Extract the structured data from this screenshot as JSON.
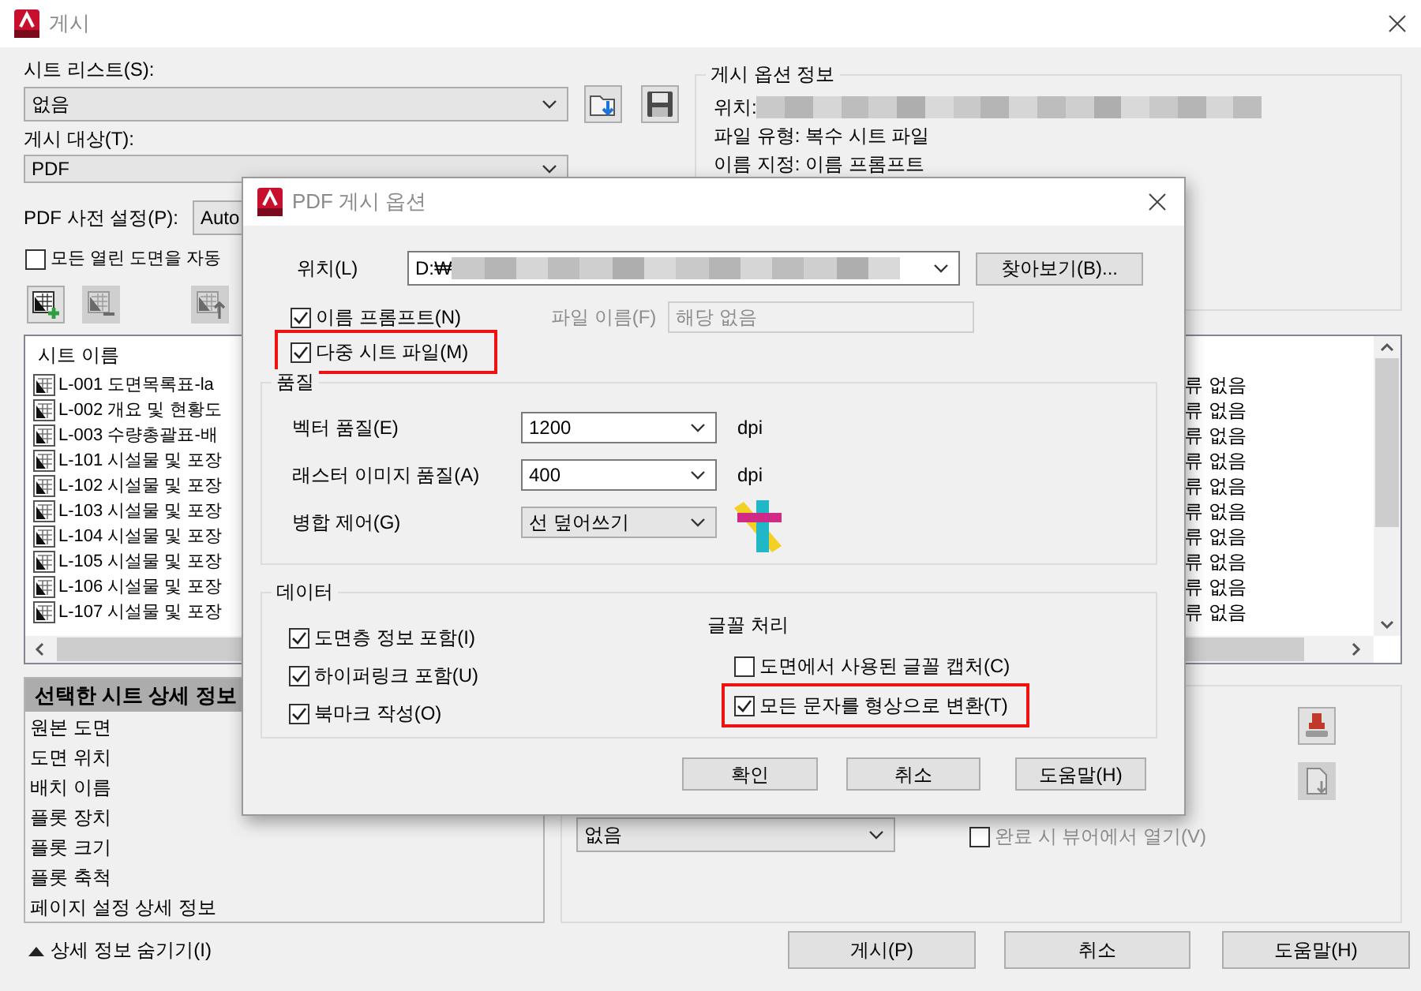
{
  "window": {
    "title": "게시"
  },
  "sheet_list": {
    "label": "시트 리스트(S):",
    "value": "없음"
  },
  "publish_to": {
    "label": "게시 대상(T):",
    "value": "PDF"
  },
  "pdf_preset": {
    "label": "PDF 사전 설정(P):",
    "value": "Auto"
  },
  "auto_load": {
    "label": "모든 열린 도면을 자동",
    "checked": false
  },
  "sheet_tools": [
    {
      "kind": "add",
      "disabled": false
    },
    {
      "kind": "remove",
      "disabled": true
    },
    {
      "kind": "move_up",
      "disabled": true
    }
  ],
  "publish_info": {
    "title": "게시 옵션 정보",
    "location_label": "위치:",
    "lines": [
      "파일 유형: 복수 시트 파일",
      "이름 지정: 이름 프롬프트"
    ]
  },
  "sheets": {
    "column_1": "시트 이름",
    "rows": [
      {
        "name": "L-001 도면목록표-la",
        "status": "류 없음"
      },
      {
        "name": "L-002 개요 및 현황도",
        "status": "류 없음"
      },
      {
        "name": "L-003 수량총괄표-배",
        "status": "류 없음"
      },
      {
        "name": "L-101 시설물 및 포장",
        "status": "류 없음"
      },
      {
        "name": "L-102 시설물 및 포장",
        "status": "류 없음"
      },
      {
        "name": "L-103 시설물 및 포장",
        "status": "류 없음"
      },
      {
        "name": "L-104 시설물 및 포장",
        "status": "류 없음"
      },
      {
        "name": "L-105 시설물 및 포장",
        "status": "류 없음"
      },
      {
        "name": "L-106 시설물 및 포장",
        "status": "류 없음"
      },
      {
        "name": "L-107 시설물 및 포장",
        "status": "류 없음"
      }
    ]
  },
  "details": {
    "header": "선택한 시트 상세 정보",
    "items": [
      "원본 도면",
      "도면 위치",
      "배치 이름",
      "플롯 장치",
      "플롯 크기",
      "플롯 축척",
      "페이지 설정 상세 정보"
    ]
  },
  "stamp": {
    "value": "없음"
  },
  "open_in_viewer": {
    "label": "완료 시 뷰어에서 열기(V)",
    "checked": false
  },
  "toggle_details": "상세 정보 숨기기(I)",
  "buttons": [
    "게시(P)",
    "취소",
    "도움말(H)"
  ],
  "dialog": {
    "title": "PDF 게시 옵션",
    "location": {
      "label": "위치(L)",
      "value": "D:₩"
    },
    "browse": "찾아보기(B)...",
    "name_prompt": {
      "label": "이름 프롬프트(N)",
      "checked": true,
      "highlighted": false
    },
    "file_name": {
      "label": "파일 이름(F)",
      "value": "해당 없음",
      "disabled": true
    },
    "multi_sheet": {
      "label": "다중 시트 파일(M)",
      "checked": true,
      "highlighted": true
    },
    "quality": {
      "title": "품질",
      "rows": [
        {
          "label": "벡터 품질(E)",
          "value": "1200",
          "unit": "dpi",
          "kind": "combo"
        },
        {
          "label": "래스터 이미지 품질(A)",
          "value": "400",
          "unit": "dpi",
          "kind": "combo"
        },
        {
          "label": "병합 제어(G)",
          "value": "선 덮어쓰기",
          "kind": "list"
        }
      ]
    },
    "data": {
      "title": "데이터",
      "options": [
        {
          "label": "도면층 정보 포함(I)",
          "checked": true,
          "highlighted": false
        },
        {
          "label": "하이퍼링크 포함(U)",
          "checked": true,
          "highlighted": false
        },
        {
          "label": "북마크 작성(O)",
          "checked": true,
          "highlighted": false
        }
      ],
      "font_title": "글꼴 처리",
      "font_options": [
        {
          "label": "도면에서 사용된 글꼴 캡처(C)",
          "checked": false,
          "highlighted": false
        },
        {
          "label": "모든 문자를 형상으로 변환(T)",
          "checked": true,
          "highlighted": true
        }
      ]
    },
    "buttons": [
      "확인",
      "취소",
      "도움말(H)"
    ]
  }
}
